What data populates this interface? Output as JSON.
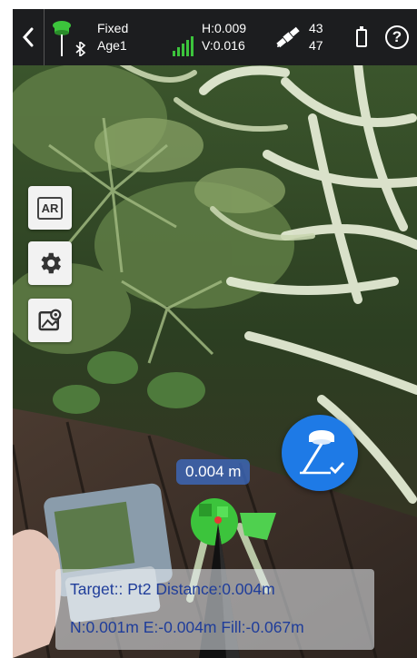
{
  "status_bar": {
    "fix_status": "Fixed",
    "age": "Age1",
    "h_precision": "H:0.009",
    "v_precision": "V:0.016",
    "satellites_used": "43",
    "satellites_visible": "47"
  },
  "tools": {
    "ar_label": "AR"
  },
  "stakeout": {
    "distance_label": "0.004 m"
  },
  "info_panel": {
    "line1": "Target:: Pt2 Distance:0.004m",
    "line2": "N:0.001m E:-0.004m Fill:-0.067m"
  },
  "colors": {
    "status_bar_bg": "#1c1d1f",
    "accent_blue": "#1e7ae6",
    "rtk_green": "#3cc43c",
    "info_text": "#1f3d9a"
  },
  "icons": [
    "back-arrow-icon",
    "rtk-receiver-icon",
    "bluetooth-icon",
    "signal-strength-icon",
    "satellite-icon",
    "battery-icon",
    "help-icon",
    "ar-icon",
    "settings-gear-icon",
    "photo-location-icon",
    "stakeout-pole-icon",
    "target-cone-icon"
  ]
}
